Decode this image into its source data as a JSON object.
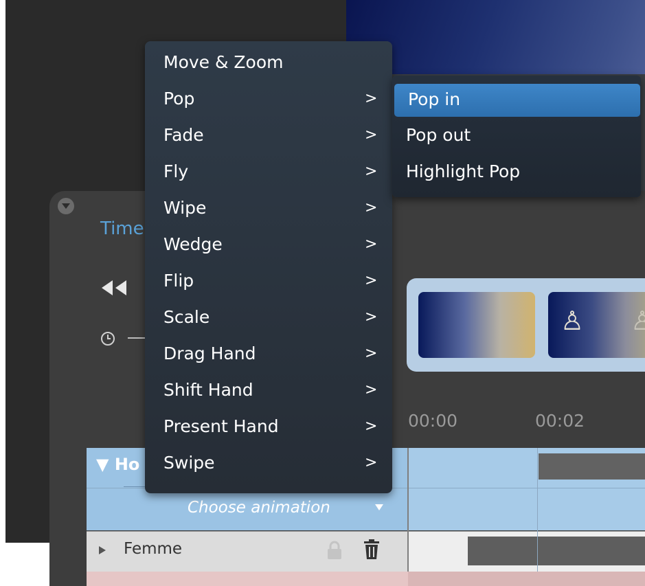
{
  "timeline": {
    "title": "Time",
    "ruler": [
      "00:00",
      "00:02"
    ]
  },
  "tracks": {
    "layer_name": "Ho",
    "choose_animation": "Choose animation",
    "rows": [
      {
        "label": "Femme"
      }
    ]
  },
  "menu": {
    "items": [
      {
        "label": "Move & Zoom",
        "arrow": ""
      },
      {
        "label": "Pop",
        "arrow": ">"
      },
      {
        "label": "Fade",
        "arrow": ">"
      },
      {
        "label": "Fly",
        "arrow": ">"
      },
      {
        "label": "Wipe",
        "arrow": ">"
      },
      {
        "label": "Wedge",
        "arrow": ">"
      },
      {
        "label": "Flip",
        "arrow": ">"
      },
      {
        "label": "Scale",
        "arrow": ">"
      },
      {
        "label": "Drag Hand",
        "arrow": ">"
      },
      {
        "label": "Shift Hand",
        "arrow": ">"
      },
      {
        "label": "Present Hand",
        "arrow": ">"
      },
      {
        "label": "Swipe",
        "arrow": ">"
      }
    ]
  },
  "submenu": {
    "items": [
      {
        "label": "Pop in",
        "selected": true
      },
      {
        "label": "Pop out",
        "selected": false
      },
      {
        "label": "Highlight Pop",
        "selected": false
      }
    ]
  },
  "colors": {
    "accent": "#3e86c8",
    "timeline_title": "#5aa2d8",
    "track_header": "#9bc3e4"
  }
}
